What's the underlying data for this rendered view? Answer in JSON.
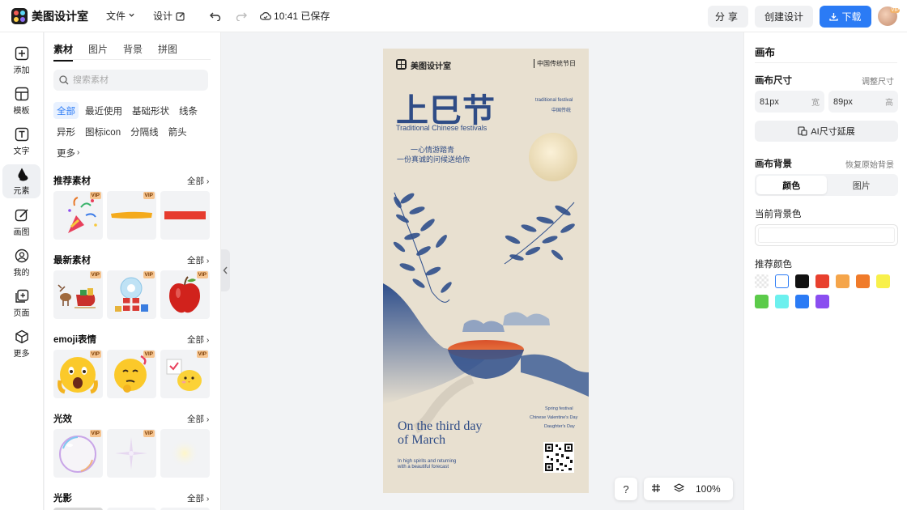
{
  "topbar": {
    "logo_text": "美图设计室",
    "file_label": "文件",
    "design_label": "设计",
    "saved_status": "10:41 已保存",
    "share_label": "分享",
    "create_label": "创建设计",
    "download_label": "下载",
    "avatar_badge": "VIP"
  },
  "rail": [
    {
      "label": "添加",
      "icon": "add-icon"
    },
    {
      "label": "模板",
      "icon": "template-icon"
    },
    {
      "label": "文字",
      "icon": "text-icon"
    },
    {
      "label": "元素",
      "icon": "element-icon",
      "active": true
    },
    {
      "label": "画图",
      "icon": "draw-icon"
    },
    {
      "label": "我的",
      "icon": "user-icon"
    },
    {
      "label": "页面",
      "icon": "page-icon"
    },
    {
      "label": "更多",
      "icon": "more-icon"
    }
  ],
  "panel": {
    "tabs": [
      "素材",
      "图片",
      "背景",
      "拼图"
    ],
    "search_placeholder": "搜索素材",
    "chips": [
      "全部",
      "最近使用",
      "基础形状",
      "线条",
      "异形",
      "图标icon",
      "分隔线",
      "箭头",
      "更多"
    ],
    "sections": [
      {
        "title": "推荐素材",
        "all": "全部"
      },
      {
        "title": "最新素材",
        "all": "全部"
      },
      {
        "title": "emoji表情",
        "all": "全部"
      },
      {
        "title": "光效",
        "all": "全部"
      },
      {
        "title": "光影",
        "all": "全部"
      }
    ],
    "vip_label": "VIP"
  },
  "poster": {
    "brand": "美图设计室",
    "tag": "中国传统节日",
    "title": "上巳节",
    "subtitle": "Traditional Chinese festivals",
    "side_small_1": "traditional festival",
    "side_small_2": "中国传统",
    "line_1": "一心情游踏青",
    "line_2": "一份真诚的问候送给你",
    "bottom_title_1": "On the third day",
    "bottom_title_2": "of March",
    "bottom_small_1": "In high spirits and returning",
    "bottom_small_2": "with a beautiful forecast",
    "right_small_1": "Spring festival",
    "right_small_2": "Chinese Valentine's Day",
    "right_small_3": "Daughter's Day"
  },
  "bottom": {
    "help": "?",
    "zoom": "100%"
  },
  "right_panel": {
    "title": "画布",
    "size_label": "画布尺寸",
    "resize_link": "调整尺寸",
    "width_value": "81px",
    "width_unit": "宽",
    "height_value": "89px",
    "height_unit": "高",
    "ai_extend": "AI尺寸延展",
    "bg_label": "画布背景",
    "restore_link": "恢复原始背景",
    "seg_color": "颜色",
    "seg_image": "图片",
    "current_bg_label": "当前背景色",
    "current_bg_color": "#ffffff",
    "recommend_label": "推荐颜色",
    "swatches": [
      "transparent",
      "#ffffff",
      "#111111",
      "#e8402e",
      "#f5a54a",
      "#f07b2a",
      "#f8f04a",
      "#5ccb4a",
      "#6cf0ee",
      "#2b7bf5",
      "#8a4ef0"
    ]
  },
  "colors": {
    "accent": "#2b7bf5",
    "poster_bg": "#e8e0d0",
    "poster_blue": "#2f4c86"
  }
}
